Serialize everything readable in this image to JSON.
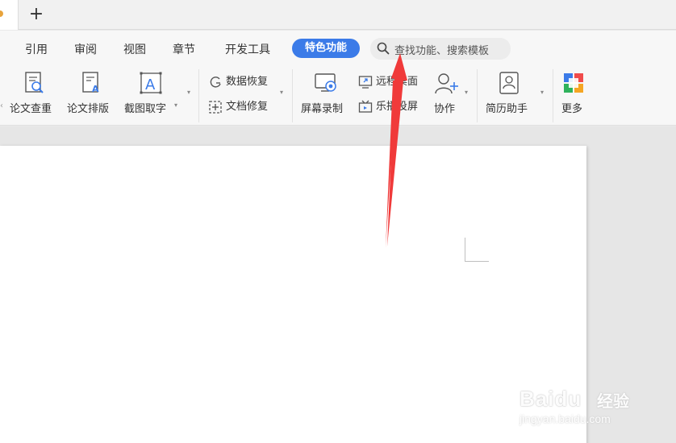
{
  "tabbar": {
    "new_tab": "+"
  },
  "menu": {
    "items": [
      "引用",
      "审阅",
      "视图",
      "章节",
      "开发工具"
    ],
    "special": "特色功能",
    "search_placeholder": "查找功能、搜索模板"
  },
  "ribbon": {
    "paper_check": "论文查重",
    "paper_format": "论文排版",
    "screenshot_ocr": "截图取字",
    "data_recovery": "数据恢复",
    "doc_repair": "文档修复",
    "screen_record": "屏幕录制",
    "remote_desktop": "远程桌面",
    "cast_screen": "乐播投屏",
    "collaborate": "协作",
    "resume_helper": "简历助手",
    "more": "更多"
  },
  "colors": {
    "accent": "#3b7be8",
    "arrow": "#f03a3a"
  },
  "watermark": {
    "brand": "Baidu",
    "sub": "经验",
    "url": "jingyan.baidu.com"
  }
}
